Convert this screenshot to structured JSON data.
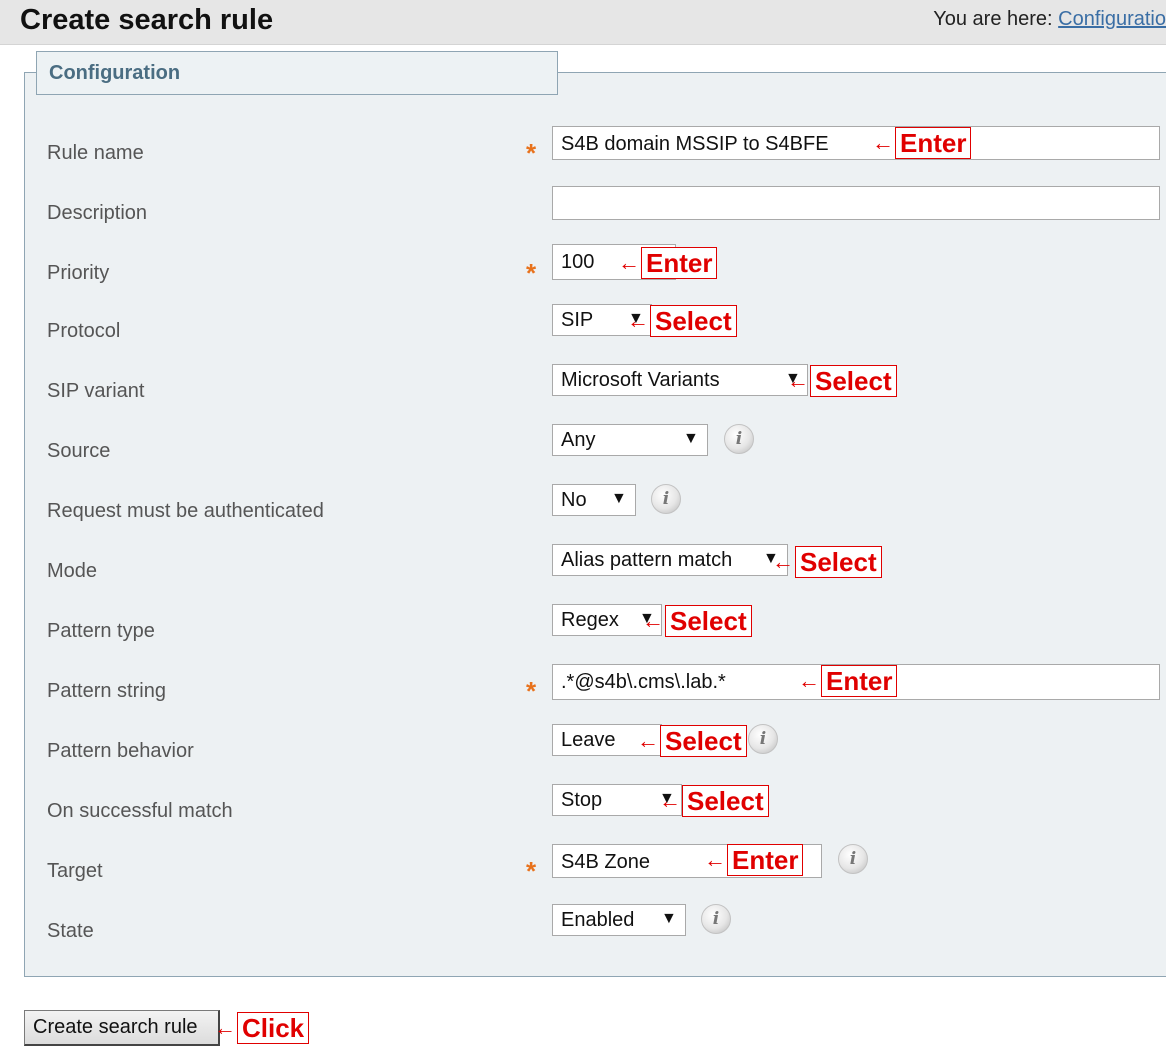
{
  "header": {
    "title": "Create search rule",
    "breadcrumb_prefix": "You are here:",
    "breadcrumb_link": "Configuratio"
  },
  "section": {
    "legend": "Configuration"
  },
  "fields": {
    "rule_name": {
      "label": "Rule name",
      "value": "S4B domain MSSIP to S4BFE",
      "required": "*"
    },
    "description": {
      "label": "Description",
      "value": ""
    },
    "priority": {
      "label": "Priority",
      "value": "100",
      "required": "*"
    },
    "protocol": {
      "label": "Protocol",
      "value": "SIP"
    },
    "sip_variant": {
      "label": "SIP variant",
      "value": "Microsoft Variants"
    },
    "source": {
      "label": "Source",
      "value": "Any"
    },
    "auth": {
      "label": "Request must be authenticated",
      "value": "No"
    },
    "mode": {
      "label": "Mode",
      "value": "Alias pattern match"
    },
    "pattern_type": {
      "label": "Pattern type",
      "value": "Regex"
    },
    "pattern_string": {
      "label": "Pattern string",
      "value": ".*@s4b\\.cms\\.lab.*",
      "required": "*"
    },
    "pattern_behavior": {
      "label": "Pattern behavior",
      "value": "Leave"
    },
    "on_match": {
      "label": "On successful match",
      "value": "Stop"
    },
    "target": {
      "label": "Target",
      "value": "S4B Zone",
      "required": "*"
    },
    "state": {
      "label": "State",
      "value": "Enabled"
    }
  },
  "annotations": {
    "arrow": "←",
    "enter": "Enter",
    "select": "Select",
    "click": "Click"
  },
  "icons": {
    "info": "i",
    "dropdown": "▼"
  },
  "submit": {
    "label": "Create search rule"
  },
  "colors": {
    "annotation_red": "#e00000",
    "required_orange": "#e8721c",
    "panel_bg": "#edf1f3",
    "link_blue": "#3a6ea5"
  }
}
